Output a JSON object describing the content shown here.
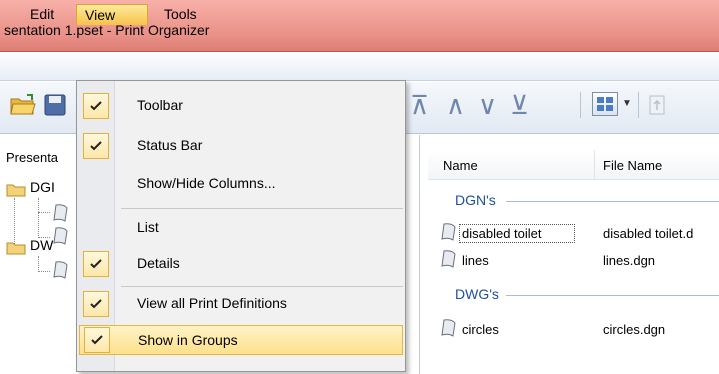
{
  "window": {
    "title": "sentation 1.pset - Print Organizer"
  },
  "menubar": {
    "edit": "Edit",
    "view": "View",
    "tools": "Tools"
  },
  "view_menu": {
    "items": [
      {
        "label": "Toolbar",
        "checked": true
      },
      {
        "label": "Status Bar",
        "checked": true
      },
      {
        "label": "Show/Hide Columns...",
        "checked": false
      },
      {
        "label": "List",
        "checked": false
      },
      {
        "label": "Details",
        "checked": true
      },
      {
        "label": "View all Print Definitions",
        "checked": true
      },
      {
        "label": "Show in Groups",
        "checked": true,
        "highlighted": true
      }
    ]
  },
  "tree": {
    "header": "Presenta",
    "nodes": [
      {
        "label": "DGI"
      },
      {
        "label": "DW"
      }
    ]
  },
  "list": {
    "columns": [
      "Name",
      "File Name"
    ],
    "groups": [
      {
        "label": "DGN's",
        "rows": [
          {
            "name": "disabled toilet",
            "file": "disabled toilet.d"
          },
          {
            "name": "lines",
            "file": "lines.dgn"
          }
        ]
      },
      {
        "label": "DWG's",
        "rows": [
          {
            "name": "circles",
            "file": "circles.dgn"
          }
        ]
      }
    ]
  },
  "colors": {
    "menu_highlight": "#fde08a",
    "group_label": "#1f4e9c",
    "titlebar": "#e99087"
  },
  "icons": [
    "open-folder-icon",
    "save-icon",
    "move-top-icon",
    "move-up-icon",
    "move-down-icon",
    "move-bottom-icon",
    "view-mode-icon",
    "disabled-action-icon",
    "folder-icon",
    "print-definition-icon",
    "checkmark-icon"
  ]
}
